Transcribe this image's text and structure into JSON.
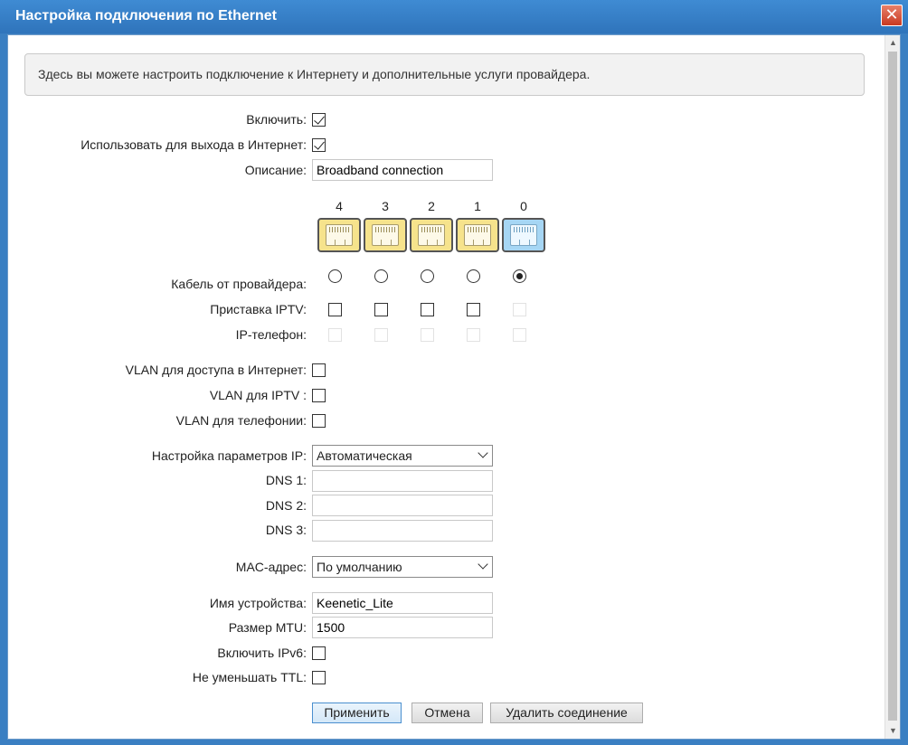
{
  "window": {
    "title": "Настройка подключения по Ethernet",
    "close_glyph": "✕"
  },
  "info": "Здесь вы можете настроить подключение к Интернету и дополнительные услуги провайдера.",
  "labels": {
    "enable": "Включить:",
    "use_internet": "Использовать для выхода в Интернет:",
    "description": "Описание:",
    "cable": "Кабель от провайдера:",
    "iptv": "Приставка IPTV:",
    "ip_phone": "IP-телефон:",
    "vlan_internet": "VLAN для доступа в Интернет:",
    "vlan_iptv": "VLAN для IPTV :",
    "vlan_phone": "VLAN для телефонии:",
    "ip_settings": "Настройка параметров IP:",
    "dns1": "DNS 1:",
    "dns2": "DNS 2:",
    "dns3": "DNS 3:",
    "mac": "MAC-адрес:",
    "device_name": "Имя устройства:",
    "mtu": "Размер MTU:",
    "ipv6": "Включить IPv6:",
    "ttl": "Не уменьшать TTL:"
  },
  "values": {
    "description": "Broadband connection",
    "ip_settings": "Автоматическая",
    "dns1": "",
    "dns2": "",
    "dns3": "",
    "mac": "По умолчанию",
    "device_name": "Keenetic_Lite",
    "mtu": "1500"
  },
  "ports": [
    "4",
    "3",
    "2",
    "1",
    "0"
  ],
  "buttons": {
    "apply": "Применить",
    "cancel": "Отмена",
    "delete": "Удалить соединение"
  },
  "colors": {
    "port_yellow": "#f6e38c",
    "port_blue": "#a6d6f4",
    "titlebar": "#3a7fc2"
  }
}
